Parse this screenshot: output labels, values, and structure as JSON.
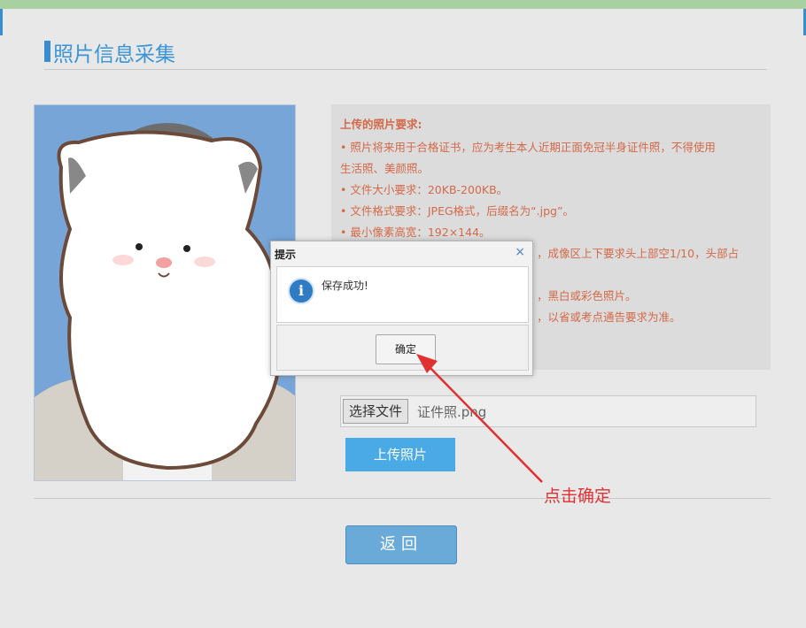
{
  "page": {
    "title": "照片信息采集"
  },
  "photo": {
    "alt": "证件照"
  },
  "requirements": {
    "title": "上传的照片要求:",
    "lines": [
      "• 照片将来用于合格证书，应为考生本人近期正面免冠半身证件照，不得使用",
      "生活照、美颜照。",
      "• 文件大小要求：20KB-200KB。",
      "• 文件格式要求：JPEG格式，后缀名为“.jpg”。",
      "• 最小像素高宽：192×144。",
      "，成像区上下要求头上部空1/10，头部占",
      "，黑白或彩色照片。",
      "，以省或考点通告要求为准。"
    ]
  },
  "file": {
    "button_label": "选择文件",
    "filename": "证件照.png"
  },
  "upload_label": "上传照片",
  "back_label": "返回",
  "dialog": {
    "title": "提示",
    "close": "×",
    "message": "保存成功!",
    "ok_label": "确定"
  },
  "annotation": {
    "text": "点击确定"
  },
  "colors": {
    "accent": "#3a95d6",
    "requirement_text": "#d36a4a",
    "annotation": "#e03030"
  }
}
